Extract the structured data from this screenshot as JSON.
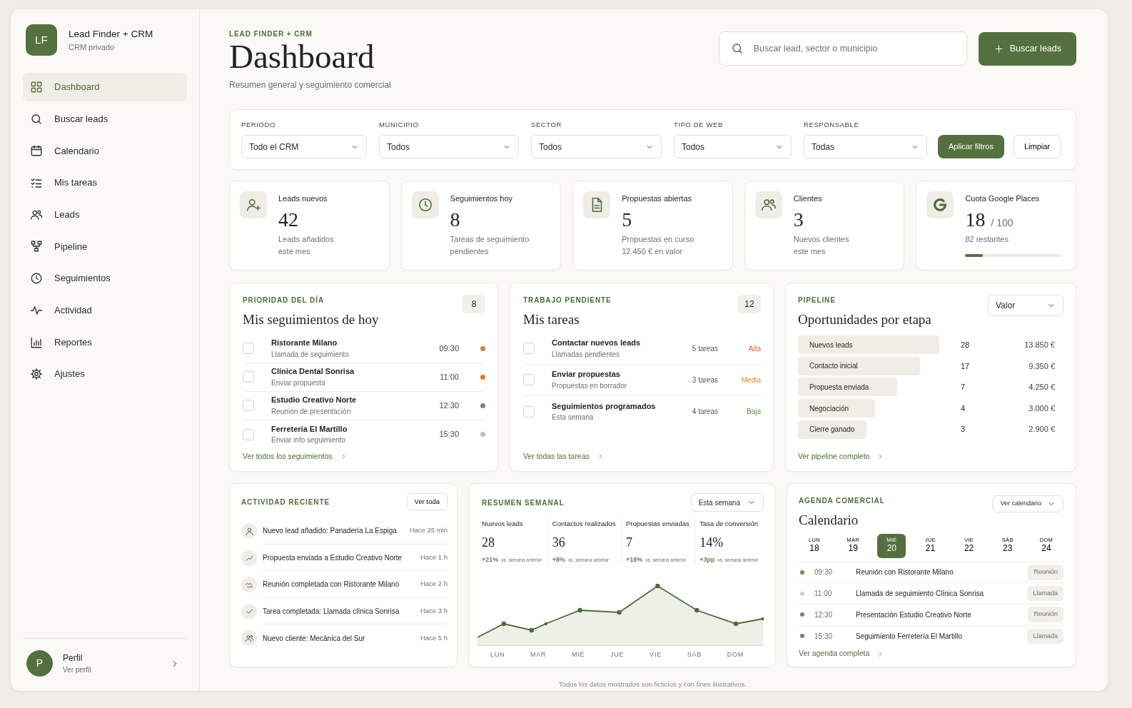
{
  "brand": {
    "logo": "LF",
    "name": "Lead Finder + CRM",
    "subtitle": "CRM privado"
  },
  "sidebar": {
    "items": [
      {
        "label": "Dashboard",
        "selected": true
      },
      {
        "label": "Buscar leads",
        "selected": false
      },
      {
        "label": "Calendario",
        "selected": false
      },
      {
        "label": "Mis tareas",
        "selected": false
      },
      {
        "label": "Leads",
        "selected": false
      },
      {
        "label": "Pipeline",
        "selected": false
      },
      {
        "label": "Seguimientos",
        "selected": false
      },
      {
        "label": "Actividad",
        "selected": false
      },
      {
        "label": "Reportes",
        "selected": false
      },
      {
        "label": "Ajustes",
        "selected": false
      }
    ]
  },
  "profile": {
    "avatar": "P",
    "name": "Perfil",
    "link": "Ver perfil"
  },
  "header": {
    "eyebrow": "LEAD FINDER + CRM",
    "title": "Dashboard",
    "subtitle": "Resumen general y seguimiento comercial"
  },
  "search": {
    "placeholder": "Buscar lead, sector o municipio"
  },
  "primary_button": "Buscar leads",
  "filters": [
    {
      "label": "PERIODO",
      "value": "Todo el CRM"
    },
    {
      "label": "MUNICIPIO",
      "value": "Todos"
    },
    {
      "label": "SECTOR",
      "value": "Todos"
    },
    {
      "label": "TIPO DE WEB",
      "value": "Todos"
    },
    {
      "label": "RESPONSABLE",
      "value": "Todas"
    }
  ],
  "filter_buttons": {
    "apply": "Aplicar filtros",
    "clear": "Limpiar"
  },
  "stats": [
    {
      "kind": "plain",
      "label": "Leads nuevos",
      "value": "42",
      "note_lines": [
        "Leads añadidos",
        "este mes"
      ]
    },
    {
      "kind": "plain",
      "label": "Seguimientos hoy",
      "value": "8",
      "note_lines": [
        "Tareas de seguimiento",
        "pendientes"
      ]
    },
    {
      "kind": "plain",
      "label": "Propuestas abiertas",
      "value": "5",
      "note_lines": [
        "Propuestas en curso",
        "12.450 € en valor"
      ]
    },
    {
      "kind": "plain",
      "label": "Clientes",
      "value": "3",
      "note_lines": [
        "Nuevos clientes",
        "este mes"
      ]
    },
    {
      "kind": "quota",
      "label": "Cuota Google Places",
      "value": "18",
      "total": "/ 100",
      "note_lines": [
        "82 restantes"
      ],
      "level": 0.18
    }
  ],
  "followups": {
    "eyebrow": "PRIORIDAD DEL DÍA",
    "title": "Mis seguimientos de hoy",
    "count": "8",
    "items": [
      {
        "name": "Ristorante Milano",
        "detail": "Llamada de seguimiento",
        "time": "09:30",
        "color": "#e8782c",
        "checked": false
      },
      {
        "name": "Clínica Dental Sonrisa",
        "detail": "Enviar propuesta",
        "time": "11:00",
        "color": "#e8782c",
        "checked": false
      },
      {
        "name": "Estudio Creativo Norte",
        "detail": "Reunión de presentación",
        "time": "12:30",
        "color": "#6b8f5a",
        "checked": false
      },
      {
        "name": "Ferretería El Martillo",
        "detail": "Enviar info seguimiento",
        "time": "15:30",
        "color": "#bdbdbd",
        "checked": false
      }
    ],
    "link": "Ver todos los seguimientos"
  },
  "tasks": {
    "eyebrow": "TRABAJO PENDIENTE",
    "title": "Mis tareas",
    "count": "12",
    "items": [
      {
        "name": "Contactar nuevos leads",
        "detail": "Llamadas pendientes",
        "amount": "5 tareas",
        "priority": "Alta",
        "color": "#e8622c",
        "checked": false
      },
      {
        "name": "Enviar propuestas",
        "detail": "Propuestas en borrador",
        "amount": "3 tareas",
        "priority": "Media",
        "color": "#e8862c",
        "checked": false
      },
      {
        "name": "Seguimientos programados",
        "detail": "Esta semana",
        "amount": "4 tareas",
        "priority": "Baja",
        "color": "#5f8a4a",
        "checked": false
      }
    ],
    "link": "Ver todas las tareas"
  },
  "pipeline": {
    "eyebrow": "PIPELINE",
    "title": "Oportunidades por etapa",
    "select": "Valor",
    "stages": [
      {
        "name": "Nuevos leads",
        "count": "28",
        "value": "13.850 €"
      },
      {
        "name": "Contacto inicial",
        "count": "17",
        "value": "9.350 €"
      },
      {
        "name": "Propuesta enviada",
        "count": "7",
        "value": "4.250 €"
      },
      {
        "name": "Negociación",
        "count": "4",
        "value": "3.000 €"
      },
      {
        "name": "Cierre ganado",
        "count": "3",
        "value": "2.900 €"
      }
    ],
    "link": "Ver pipeline completo"
  },
  "activity": {
    "eyebrow": "ACTIVIDAD RECIENTE",
    "button": "Ver toda",
    "items": [
      {
        "text": "Nuevo lead añadido: Panadería La Espiga",
        "time": "Hace 25 min"
      },
      {
        "text": "Propuesta enviada a Estudio Creativo Norte",
        "time": "Hace 1 h"
      },
      {
        "text": "Reunión completada con Ristorante Milano",
        "time": "Hace 2 h"
      },
      {
        "text": "Tarea completada: Llamada clínica Sonrisa",
        "time": "Hace 3 h"
      },
      {
        "text": "Nuevo cliente: Mecánica del Sur",
        "time": "Hace 5 h"
      }
    ]
  },
  "weekly": {
    "eyebrow": "RESUMEN SEMANAL",
    "select": "Esta semana",
    "metrics": [
      {
        "label": "Nuevos leads",
        "value": "28",
        "change": "+21%",
        "note": "vs. semana anterior"
      },
      {
        "label": "Contactos realizados",
        "value": "36",
        "change": "+8%",
        "note": "vs. semana anterior"
      },
      {
        "label": "Propuestas enviadas",
        "value": "7",
        "change": "+16%",
        "note": "vs. semana anterior"
      },
      {
        "label": "Tasa de conversión",
        "value": "14%",
        "change": "+3pp",
        "note": "vs. semana anterior"
      }
    ],
    "days": [
      "LUN",
      "MAR",
      "MIÉ",
      "JUE",
      "VIE",
      "SÁB",
      "DOM"
    ]
  },
  "calendar": {
    "eyebrow": "AGENDA COMERCIAL",
    "title": "Calendario",
    "select": "Ver calendario",
    "days": [
      {
        "weekday": "LUN",
        "date": "18",
        "selected": false
      },
      {
        "weekday": "MAR",
        "date": "19",
        "selected": false
      },
      {
        "weekday": "MIÉ",
        "date": "20",
        "selected": true
      },
      {
        "weekday": "JUE",
        "date": "21",
        "selected": false
      },
      {
        "weekday": "VIE",
        "date": "22",
        "selected": false
      },
      {
        "weekday": "SÁB",
        "date": "23",
        "selected": false
      },
      {
        "weekday": "DOM",
        "date": "24",
        "selected": false
      }
    ],
    "events": [
      {
        "time": "09:30",
        "title": "Reunión con Ristorante Milano",
        "tag": "Reunión",
        "color": "#6b8f5a"
      },
      {
        "time": "11:00",
        "title": "Llamada de seguimiento Clínica Sonrisa",
        "tag": "Llamada",
        "color": "#cfcfcf"
      },
      {
        "time": "12:30",
        "title": "Presentación Estudio Creativo Norte",
        "tag": "Reunión",
        "color": "#6b8f5a"
      },
      {
        "time": "15:30",
        "title": "Seguimiento Ferretería El Martillo",
        "tag": "Llamada",
        "color": "#6b8f5a"
      }
    ],
    "link": "Ver agenda completa"
  },
  "footer": "Todos los datos mostrados son ficticios y con fines ilustrativos."
}
